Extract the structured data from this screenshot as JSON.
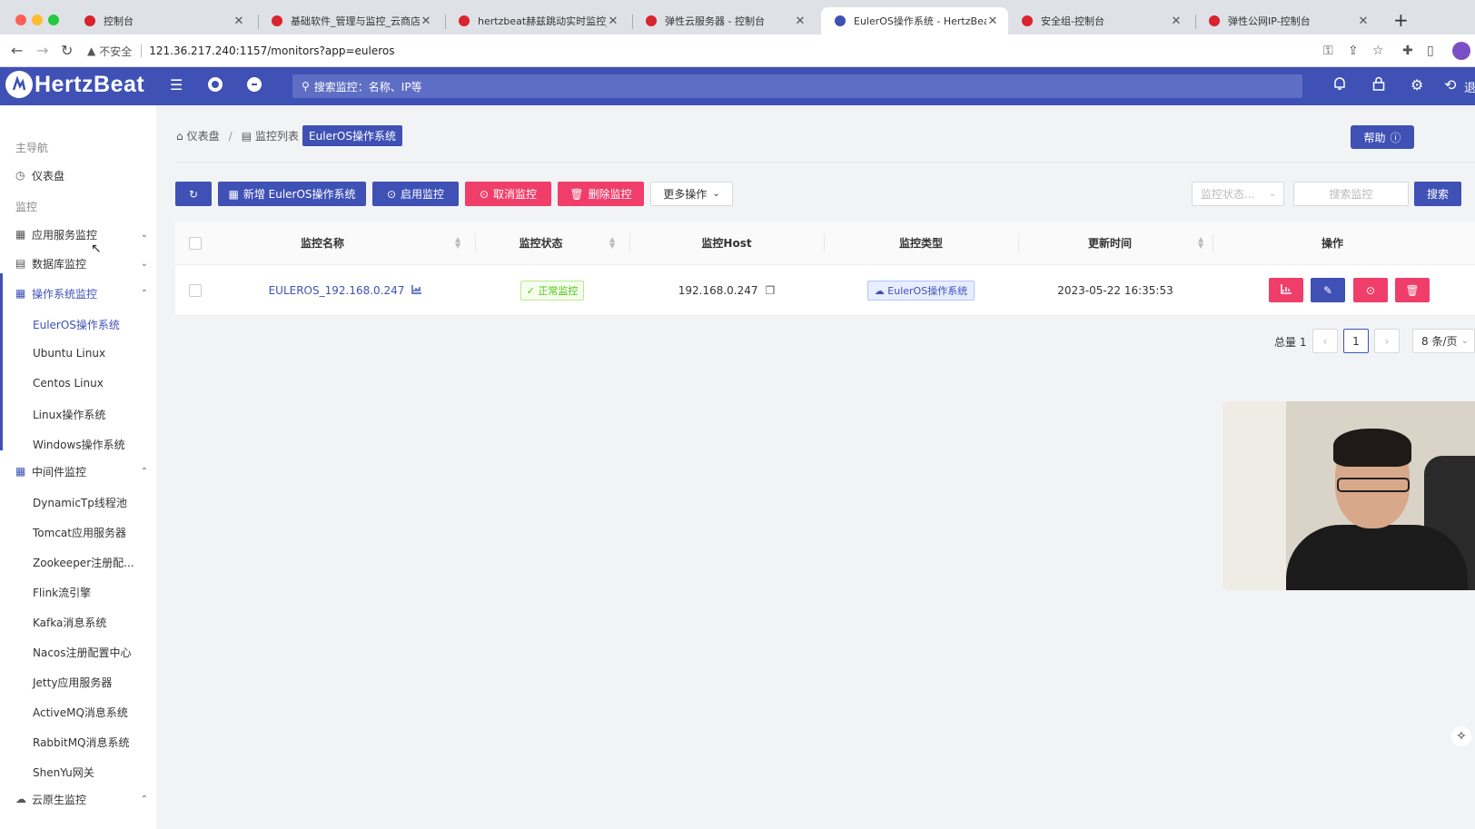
{
  "browser": {
    "tabs": [
      {
        "label": "控制台",
        "active": false
      },
      {
        "label": "基础软件_管理与监控_云商店-华",
        "active": false
      },
      {
        "label": "hertzbeat赫兹跳动实时监控_监",
        "active": false
      },
      {
        "label": "弹性云服务器 - 控制台",
        "active": false
      },
      {
        "label": "EulerOS操作系统 - HertzBeat",
        "active": true
      },
      {
        "label": "安全组-控制台",
        "active": false
      },
      {
        "label": "弹性公网IP-控制台",
        "active": false
      }
    ],
    "insecure_label": "不安全",
    "url": "121.36.217.240:1157/monitors?app=euleros"
  },
  "header": {
    "logo_text": "HertzBeat",
    "search_placeholder": "搜索监控：名称、IP等",
    "right_text": "退"
  },
  "sidebar": {
    "sections": {
      "main_nav": "主导航",
      "monitor": "监控"
    },
    "dashboard": "仪表盘",
    "groups": [
      {
        "label": "应用服务监控",
        "expanded": false
      },
      {
        "label": "数据库监控",
        "expanded": false
      },
      {
        "label": "操作系统监控",
        "expanded": true
      },
      {
        "label": "中间件监控",
        "expanded": true
      },
      {
        "label": "云原生监控",
        "expanded": true
      }
    ],
    "os_items": [
      "EulerOS操作系统",
      "Ubuntu Linux",
      "Centos Linux",
      "Linux操作系统",
      "Windows操作系统"
    ],
    "middleware_items": [
      "DynamicTp线程池",
      "Tomcat应用服务器",
      "Zookeeper注册配...",
      "Flink流引擎",
      "Kafka消息系统",
      "Nacos注册配置中心",
      "Jetty应用服务器",
      "ActiveMQ消息系统",
      "RabbitMQ消息系统",
      "ShenYu网关"
    ]
  },
  "breadcrumb": {
    "home": "仪表盘",
    "list": "监控列表",
    "current": "EulerOS操作系统"
  },
  "help_label": "帮助",
  "toolbar": {
    "add": "新增 EulerOS操作系统",
    "enable": "启用监控",
    "cancel": "取消监控",
    "delete": "删除监控",
    "more": "更多操作",
    "status_placeholder": "监控状态...",
    "search_placeholder": "搜索监控",
    "search": "搜索"
  },
  "table": {
    "columns": [
      "监控名称",
      "监控状态",
      "监控Host",
      "监控类型",
      "更新时间",
      "操作"
    ],
    "rows": [
      {
        "name": "EULEROS_192.168.0.247",
        "status": "正常监控",
        "host": "192.168.0.247",
        "type": "EulerOS操作系统",
        "updated": "2023-05-22 16:35:53"
      }
    ]
  },
  "pagination": {
    "total_label": "总量 1",
    "current_page": "1",
    "page_size": "8 条/页"
  },
  "colors": {
    "primary": "#3f51b5",
    "danger": "#f03e6a",
    "success": "#52c41a"
  }
}
